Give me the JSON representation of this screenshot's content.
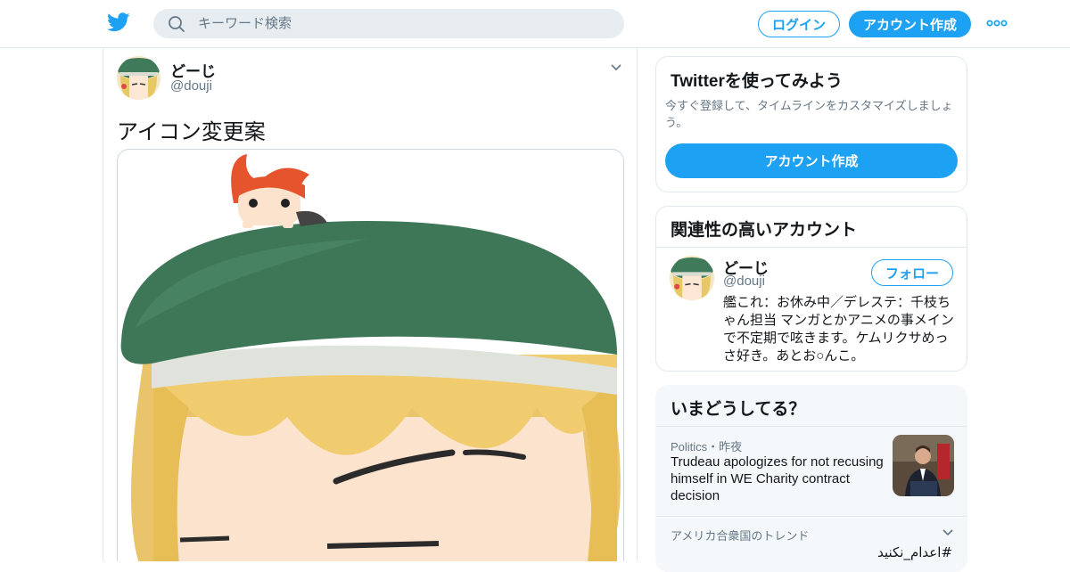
{
  "header": {
    "logo_icon": "twitter-bird-icon",
    "search_placeholder": "キーワード検索",
    "login_label": "ログイン",
    "signup_label": "アカウント作成",
    "more_icon": "more-dots-icon",
    "accent_color": "#1da1f2"
  },
  "tweet": {
    "author_name": "どーじ",
    "author_handle": "@douji",
    "text": "アイコン変更案",
    "caret_icon": "chevron-down-icon"
  },
  "signup_card": {
    "title": "Twitterを使ってみよう",
    "subtitle": "今すぐ登録して、タイムラインをカスタマイズしましょう。",
    "button_label": "アカウント作成"
  },
  "related_card": {
    "title": "関連性の高いアカウント",
    "account": {
      "name": "どーじ",
      "handle": "@douji",
      "follow_label": "フォロー",
      "bio": "艦これ：お休み中／デレステ：千枝ちゃん担当 マンガとかアニメの事メインで不定期で呟きます。ケムリクサめっさ好き。あとお○んこ。"
    }
  },
  "trends_card": {
    "title": "いまどうしてる？",
    "news": {
      "meta": "Politics・昨夜",
      "headline": "Trudeau apologizes for not recusing himself in WE Charity contract decision"
    },
    "region_label": "アメリカ合衆国のトレンド",
    "trend_tag": "#اعدام_نکنید"
  }
}
